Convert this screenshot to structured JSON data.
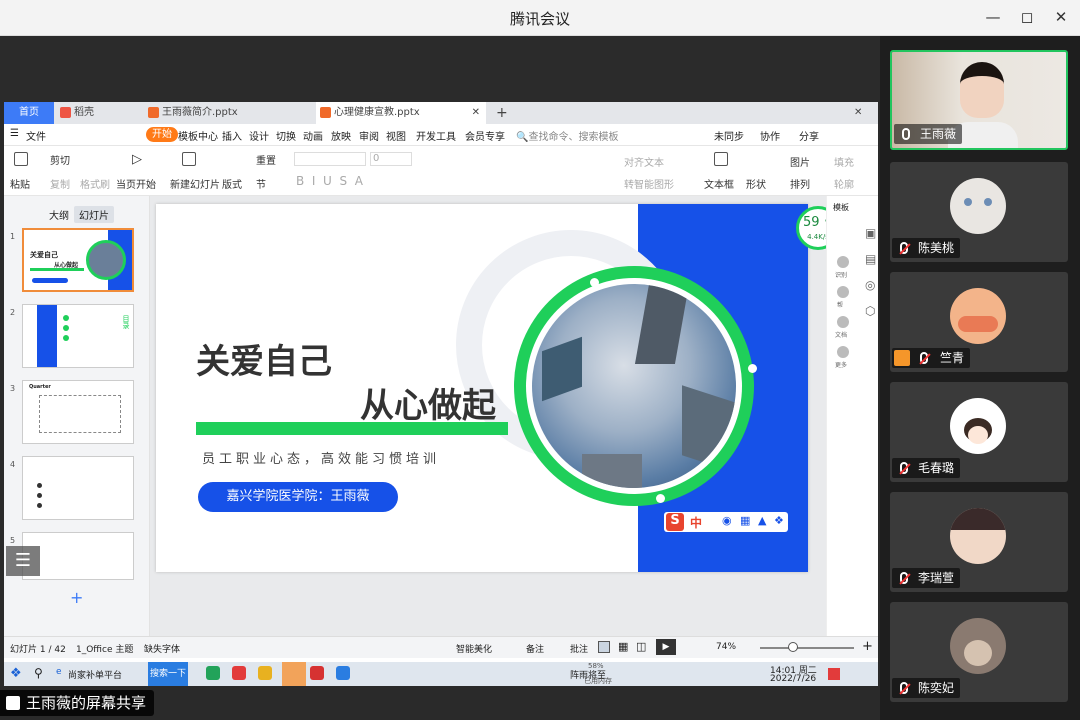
{
  "window": {
    "title": "腾讯会议"
  },
  "wps": {
    "tabs": [
      "首页",
      "稻壳",
      "王雨薇简介.pptx",
      "心理健康宣教.pptx"
    ],
    "menu": [
      "文件",
      "开始",
      "模板中心",
      "插入",
      "设计",
      "切换",
      "动画",
      "放映",
      "审阅",
      "视图",
      "开发工具",
      "会员专享"
    ],
    "search_placeholder": "查找命令、搜索模板",
    "right_actions": [
      "未同步",
      "协作",
      "分享"
    ],
    "toolbar": {
      "paste": "粘贴",
      "cut": "剪切",
      "copy": "复制",
      "format_painter": "格式刷",
      "from_current": "当页开始",
      "new_slide": "新建幻灯片",
      "layout": "版式",
      "section": "节",
      "reset": "重置",
      "font_size": "0",
      "align_text": "对齐文本",
      "convert_shape": "转智能图形",
      "textbox": "文本框",
      "shape": "形状",
      "picture": "图片",
      "arrange": "排列",
      "fill": "填充",
      "outline": "轮廓"
    },
    "panel_tabs": [
      "大纲",
      "幻灯片"
    ],
    "thumb_numbers": [
      "1",
      "2",
      "3",
      "4",
      "5"
    ],
    "thumb_text": {
      "t1_title1": "关爱自己",
      "t1_title2": "从心做起",
      "t2_toc": "目录",
      "t3_head": "Quarter"
    },
    "slide": {
      "title1": "关爱自己",
      "title2": "从心做起",
      "subtitle": "员工职业心态，高效能习惯培训",
      "presenter": "嘉兴学院医学院：王雨薇"
    },
    "speed": {
      "percent": "59",
      "unit": "%",
      "rate": "4.4K/s"
    },
    "right_panel": [
      "模板",
      "识别",
      "帮",
      "文档",
      "更多"
    ],
    "ime": [
      "中"
    ],
    "status": {
      "slide_count": "幻灯片 1 / 42",
      "theme": "1_Office 主题",
      "missing_font": "缺失字体",
      "smart": "智能美化",
      "notes": "备注",
      "comment": "批注",
      "zoom": "74%"
    }
  },
  "taskbar": {
    "browser": "尚家补单平台",
    "search": "搜索一下",
    "weather": "阵雨将至",
    "weather2": "已用内存",
    "time": "14:01 周二",
    "date": "2022/7/26",
    "chrome_extra": "58%"
  },
  "participants": [
    {
      "name": "王雨薇",
      "muted": false,
      "active": true
    },
    {
      "name": "陈美桃",
      "muted": true
    },
    {
      "name": "竺青",
      "muted": true
    },
    {
      "name": "毛春璐",
      "muted": true
    },
    {
      "name": "李瑞萱",
      "muted": true
    },
    {
      "name": "陈奕妃",
      "muted": true
    }
  ],
  "share_label": "王雨薇的屏幕共享",
  "colors": {
    "green": "#1fcf5a",
    "blue": "#1651e8",
    "accent_orange": "#ff7a17"
  }
}
